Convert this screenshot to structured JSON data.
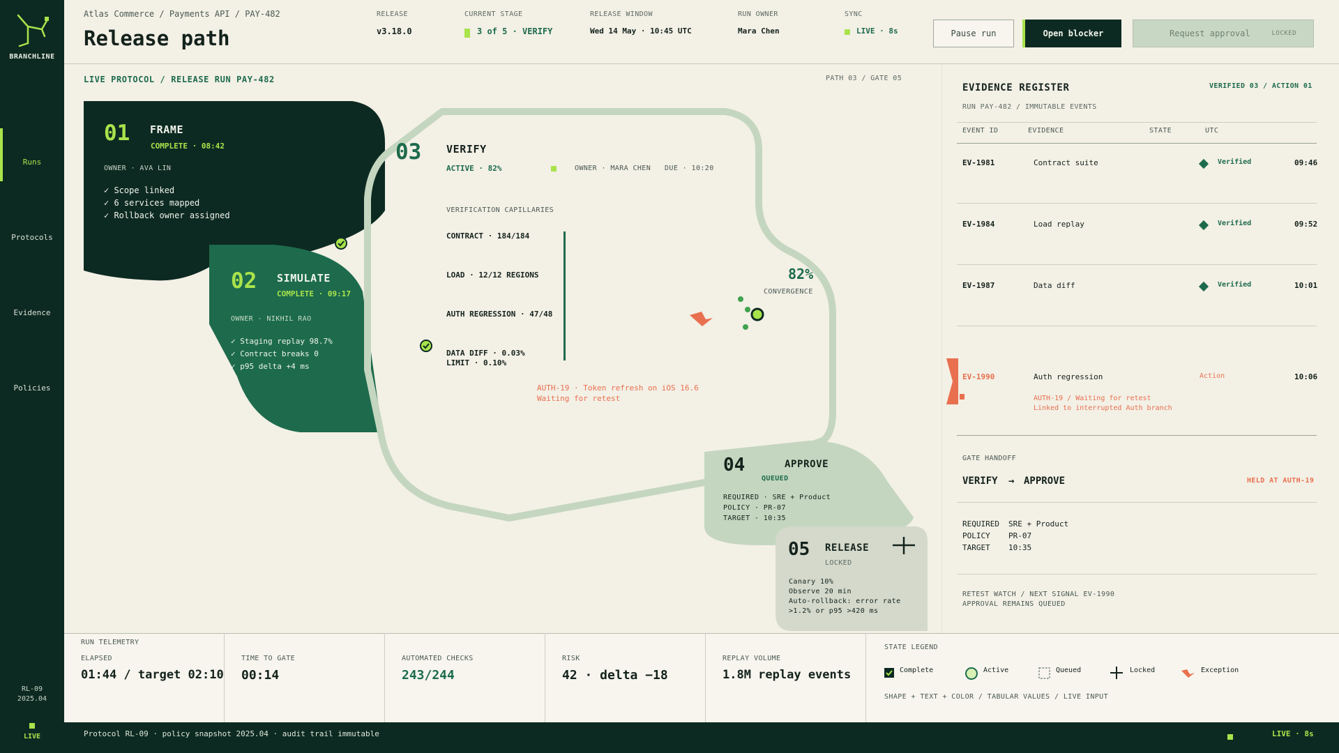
{
  "app": {
    "brand": "BRANCHLINE",
    "logo_icon": "branch-network-icon"
  },
  "sidebar": {
    "items": [
      {
        "label": "Runs",
        "active": true
      },
      {
        "label": "Protocols",
        "active": false
      },
      {
        "label": "Evidence",
        "active": false
      },
      {
        "label": "Policies",
        "active": false
      }
    ],
    "version": "RL-09",
    "version_date": "2025.04",
    "live_label": "LIVE"
  },
  "header": {
    "breadcrumb": "Atlas Commerce / Payments API / PAY-482",
    "title": "Release path",
    "release_label": "RELEASE",
    "release_value": "v3.18.0",
    "stage_label": "CURRENT STAGE",
    "stage_value": "3 of 5 · VERIFY",
    "window_label": "RELEASE WINDOW",
    "window_value": "Wed 14 May · 10:45 UTC",
    "owner_label": "RUN OWNER",
    "owner_value": "Mara Chen",
    "sync_label": "SYNC",
    "sync_value": "LIVE · 8s",
    "buttons": {
      "pause": "Pause run",
      "blocker": "Open blocker",
      "approval": "Request approval",
      "approval_tag": "LOCKED"
    }
  },
  "canvas": {
    "section_label": "LIVE PROTOCOL / RELEASE RUN PAY-482",
    "path_gate": "PATH 03 / GATE 05",
    "steps": {
      "frame": {
        "num": "01",
        "title": "FRAME",
        "status": "COMPLETE · 08:42",
        "owner": "OWNER · AVA LIN",
        "items": [
          "✓ Scope linked",
          "✓ 6 services mapped",
          "✓ Rollback owner assigned"
        ]
      },
      "simulate": {
        "num": "02",
        "title": "SIMULATE",
        "status": "COMPLETE · 09:17",
        "owner": "OWNER · NIKHIL RAO",
        "items": [
          "✓ Staging replay 98.7%",
          "✓ Contract breaks 0",
          "✓ p95 delta +4 ms"
        ]
      },
      "verify": {
        "num": "03",
        "title": "VERIFY",
        "status": "ACTIVE · 82%",
        "owner": "OWNER · MARA CHEN",
        "due": "DUE · 10:20",
        "capillaries_label": "VERIFICATION CAPILLARIES",
        "capillaries": [
          "CONTRACT · 184/184",
          "LOAD · 12/12 REGIONS",
          "AUTH REGRESSION · 47/48"
        ],
        "data_diff": "DATA DIFF · 0.03%",
        "limit": "LIMIT · 0.10%",
        "exception": "AUTH-19 · Token refresh on iOS 16.6",
        "exception_sub": "Waiting for retest",
        "convergence_value": "82%",
        "convergence_label": "CONVERGENCE"
      },
      "approve": {
        "num": "04",
        "title": "APPROVE",
        "status": "QUEUED",
        "items": [
          "REQUIRED · SRE + Product",
          "POLICY · PR-07",
          "TARGET · 10:35"
        ]
      },
      "release": {
        "num": "05",
        "title": "RELEASE",
        "status": "LOCKED",
        "items": [
          "Canary 10%",
          "Observe 20 min",
          "Auto-rollback: error rate",
          ">1.2% or p95 >420 ms"
        ]
      }
    }
  },
  "register": {
    "title": "EVIDENCE REGISTER",
    "count": "VERIFIED 03 / ACTION 01",
    "subtitle": "RUN PAY-482 / IMMUTABLE EVENTS",
    "columns": [
      "EVENT ID",
      "EVIDENCE",
      "STATE",
      "UTC"
    ],
    "rows": [
      {
        "id": "EV-1981",
        "evidence": "Contract suite",
        "state": "Verified",
        "utc": "09:46"
      },
      {
        "id": "EV-1984",
        "evidence": "Load replay",
        "state": "Verified",
        "utc": "09:52"
      },
      {
        "id": "EV-1987",
        "evidence": "Data diff",
        "state": "Verified",
        "utc": "10:01"
      },
      {
        "id": "EV-1990",
        "evidence": "Auth regression",
        "state": "Action",
        "utc": "10:06",
        "note1": "AUTH-19 / Waiting for retest",
        "note2": "Linked to interrupted Auth branch"
      }
    ],
    "handoff_label": "GATE HANDOFF",
    "handoff_from": "VERIFY",
    "handoff_arrow": "→",
    "handoff_to": "APPROVE",
    "handoff_status": "HELD AT AUTH-19",
    "handoff_details": [
      {
        "key": "REQUIRED",
        "value": "SRE + Product"
      },
      {
        "key": "POLICY",
        "value": "PR-07"
      },
      {
        "key": "TARGET",
        "value": "10:35"
      }
    ],
    "watch1": "RETEST WATCH / NEXT SIGNAL EV-1990",
    "watch2": "APPROVAL REMAINS QUEUED"
  },
  "telemetry": {
    "section": "RUN TELEMETRY",
    "elapsed_label": "ELAPSED",
    "elapsed_value": "01:44 / target 02:10",
    "gate_label": "TIME TO GATE",
    "gate_value": "00:14",
    "checks_label": "AUTOMATED CHECKS",
    "checks_value": "243/244",
    "risk_label": "RISK",
    "risk_value": "42 · delta −18",
    "replay_label": "REPLAY VOLUME",
    "replay_value": "1.8M replay events",
    "legend_label": "STATE LEGEND",
    "legend": [
      "Complete",
      "Active",
      "Queued",
      "Locked",
      "Exception"
    ],
    "legend_note": "SHAPE + TEXT + COLOR / TABULAR VALUES / LIVE INPUT"
  },
  "footer": {
    "text": "Protocol RL-09 · policy snapshot 2025.04 · audit trail immutable",
    "live": "LIVE · 8s"
  },
  "colors": {
    "dark": "#0d2a22",
    "green": "#1d6b4c",
    "lime": "#a9e34b",
    "exception": "#e8704e",
    "approve": "#c4d6bf",
    "release": "#d4d9cc",
    "background": "#f3f0e6"
  }
}
